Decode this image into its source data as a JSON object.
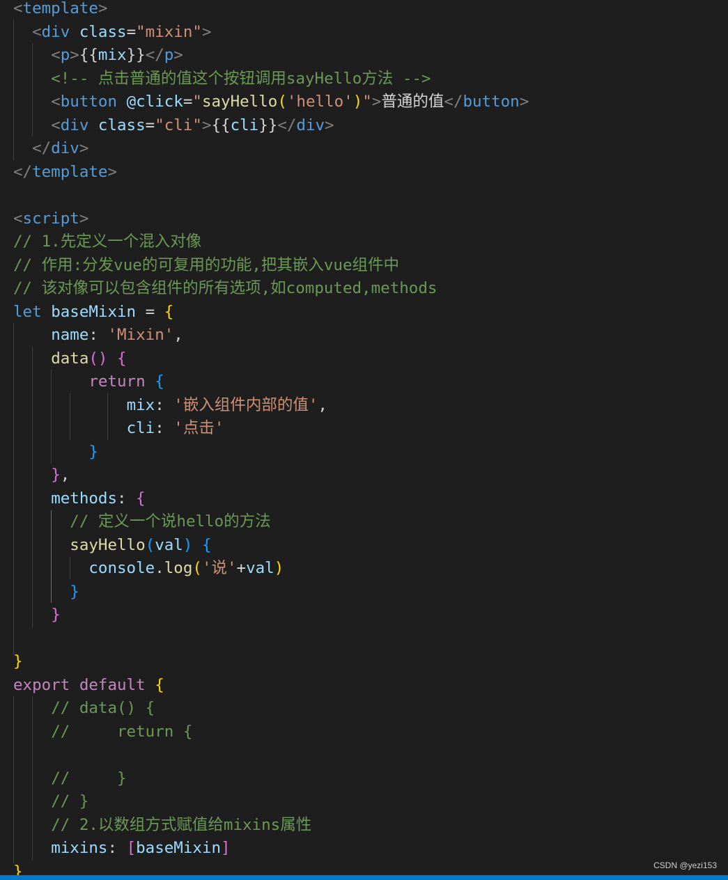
{
  "watermark": "CSDN @yezi153",
  "colors": {
    "background": "#1e1e1e",
    "tag": "#569cd6",
    "attribute": "#9cdcfe",
    "string": "#ce9178",
    "comment": "#6a9955",
    "function": "#dcdcaa",
    "control_keyword": "#c586c0",
    "bracket_level1": "#ffd700",
    "bracket_level2": "#da70d6",
    "bracket_level3": "#179fff",
    "status_bar": "#007acc"
  },
  "code": [
    [
      [
        "punc",
        "<"
      ],
      [
        "tag",
        "template"
      ],
      [
        "punc",
        ">"
      ]
    ],
    [
      [
        "txt",
        "  "
      ],
      [
        "punc",
        "<"
      ],
      [
        "tag",
        "div"
      ],
      [
        "txt",
        " "
      ],
      [
        "attr",
        "class"
      ],
      [
        "txt",
        "="
      ],
      [
        "str",
        "\"mixin\""
      ],
      [
        "punc",
        ">"
      ]
    ],
    [
      [
        "txt",
        "    "
      ],
      [
        "punc",
        "<"
      ],
      [
        "tag",
        "p"
      ],
      [
        "punc",
        ">"
      ],
      [
        "mus",
        "{{"
      ],
      [
        "var",
        "mix"
      ],
      [
        "mus",
        "}}"
      ],
      [
        "punc",
        "</"
      ],
      [
        "tag",
        "p"
      ],
      [
        "punc",
        ">"
      ]
    ],
    [
      [
        "txt",
        "    "
      ],
      [
        "cmt",
        "<!-- 点击普通的值这个按钮调用sayHello方法 -->"
      ]
    ],
    [
      [
        "txt",
        "    "
      ],
      [
        "punc",
        "<"
      ],
      [
        "tag",
        "button"
      ],
      [
        "txt",
        " "
      ],
      [
        "attr",
        "@click"
      ],
      [
        "txt",
        "="
      ],
      [
        "str",
        "\""
      ],
      [
        "fn",
        "sayHello"
      ],
      [
        "b1",
        "("
      ],
      [
        "str",
        "'hello'"
      ],
      [
        "b1",
        ")"
      ],
      [
        "str",
        "\""
      ],
      [
        "punc",
        ">"
      ],
      [
        "txt",
        "普通的值"
      ],
      [
        "punc",
        "</"
      ],
      [
        "tag",
        "button"
      ],
      [
        "punc",
        ">"
      ]
    ],
    [
      [
        "txt",
        "    "
      ],
      [
        "punc",
        "<"
      ],
      [
        "tag",
        "div"
      ],
      [
        "txt",
        " "
      ],
      [
        "attr",
        "class"
      ],
      [
        "txt",
        "="
      ],
      [
        "str",
        "\"cli\""
      ],
      [
        "punc",
        ">"
      ],
      [
        "mus",
        "{{"
      ],
      [
        "var",
        "cli"
      ],
      [
        "mus",
        "}}"
      ],
      [
        "punc",
        "</"
      ],
      [
        "tag",
        "div"
      ],
      [
        "punc",
        ">"
      ]
    ],
    [
      [
        "txt",
        "  "
      ],
      [
        "punc",
        "</"
      ],
      [
        "tag",
        "div"
      ],
      [
        "punc",
        ">"
      ]
    ],
    [
      [
        "punc",
        "</"
      ],
      [
        "tag",
        "template"
      ],
      [
        "punc",
        ">"
      ]
    ],
    [],
    [
      [
        "punc",
        "<"
      ],
      [
        "tag",
        "script"
      ],
      [
        "punc",
        ">"
      ]
    ],
    [
      [
        "cmt",
        "// 1.先定义一个混入对像"
      ]
    ],
    [
      [
        "cmt",
        "// 作用:分发vue的可复用的功能,把其嵌入vue组件中"
      ]
    ],
    [
      [
        "cmt",
        "// 该对像可以包含组件的所有选项,如computed,methods"
      ]
    ],
    [
      [
        "kw",
        "let"
      ],
      [
        "txt",
        " "
      ],
      [
        "var",
        "baseMixin"
      ],
      [
        "txt",
        " = "
      ],
      [
        "b1",
        "{"
      ]
    ],
    [
      [
        "txt",
        "    "
      ],
      [
        "var",
        "name"
      ],
      [
        "txt",
        ": "
      ],
      [
        "str",
        "'Mixin'"
      ],
      [
        "txt",
        ","
      ]
    ],
    [
      [
        "txt",
        "    "
      ],
      [
        "fn",
        "data"
      ],
      [
        "b2",
        "()"
      ],
      [
        "txt",
        " "
      ],
      [
        "b2",
        "{"
      ]
    ],
    [
      [
        "txt",
        "        "
      ],
      [
        "ctl",
        "return"
      ],
      [
        "txt",
        " "
      ],
      [
        "b3",
        "{"
      ]
    ],
    [
      [
        "txt",
        "            "
      ],
      [
        "var",
        "mix"
      ],
      [
        "txt",
        ": "
      ],
      [
        "str",
        "'嵌入组件内部的值'"
      ],
      [
        "txt",
        ","
      ]
    ],
    [
      [
        "txt",
        "            "
      ],
      [
        "var",
        "cli"
      ],
      [
        "txt",
        ": "
      ],
      [
        "str",
        "'点击'"
      ]
    ],
    [
      [
        "txt",
        "        "
      ],
      [
        "b3",
        "}"
      ]
    ],
    [
      [
        "txt",
        "    "
      ],
      [
        "b2",
        "}"
      ],
      [
        "txt",
        ","
      ]
    ],
    [
      [
        "txt",
        "    "
      ],
      [
        "var",
        "methods"
      ],
      [
        "txt",
        ": "
      ],
      [
        "b2",
        "{"
      ]
    ],
    [
      [
        "txt",
        "      "
      ],
      [
        "cmt",
        "// 定义一个说hello的方法"
      ]
    ],
    [
      [
        "txt",
        "      "
      ],
      [
        "fn",
        "sayHello"
      ],
      [
        "b3",
        "("
      ],
      [
        "var",
        "val"
      ],
      [
        "b3",
        ")"
      ],
      [
        "txt",
        " "
      ],
      [
        "b3",
        "{"
      ]
    ],
    [
      [
        "txt",
        "        "
      ],
      [
        "var",
        "console"
      ],
      [
        "txt",
        "."
      ],
      [
        "fn",
        "log"
      ],
      [
        "b1",
        "("
      ],
      [
        "str",
        "'说'"
      ],
      [
        "txt",
        "+"
      ],
      [
        "var",
        "val"
      ],
      [
        "b1",
        ")"
      ]
    ],
    [
      [
        "txt",
        "      "
      ],
      [
        "b3",
        "}"
      ]
    ],
    [
      [
        "txt",
        "    "
      ],
      [
        "b2",
        "}"
      ]
    ],
    [],
    [
      [
        "b1",
        "}"
      ]
    ],
    [
      [
        "ctl",
        "export"
      ],
      [
        "txt",
        " "
      ],
      [
        "ctl",
        "default"
      ],
      [
        "txt",
        " "
      ],
      [
        "b1",
        "{"
      ]
    ],
    [
      [
        "txt",
        "    "
      ],
      [
        "cmt",
        "// data() {"
      ]
    ],
    [
      [
        "txt",
        "    "
      ],
      [
        "cmt",
        "//     return {"
      ]
    ],
    [],
    [
      [
        "txt",
        "    "
      ],
      [
        "cmt",
        "//     }"
      ]
    ],
    [
      [
        "txt",
        "    "
      ],
      [
        "cmt",
        "// }"
      ]
    ],
    [
      [
        "txt",
        "    "
      ],
      [
        "cmt",
        "// 2.以数组方式赋值给mixins属性"
      ]
    ],
    [
      [
        "txt",
        "    "
      ],
      [
        "var",
        "mixins"
      ],
      [
        "txt",
        ": "
      ],
      [
        "b2",
        "["
      ],
      [
        "var",
        "baseMixin"
      ],
      [
        "b2",
        "]"
      ]
    ],
    [
      [
        "b1",
        "}"
      ]
    ]
  ]
}
